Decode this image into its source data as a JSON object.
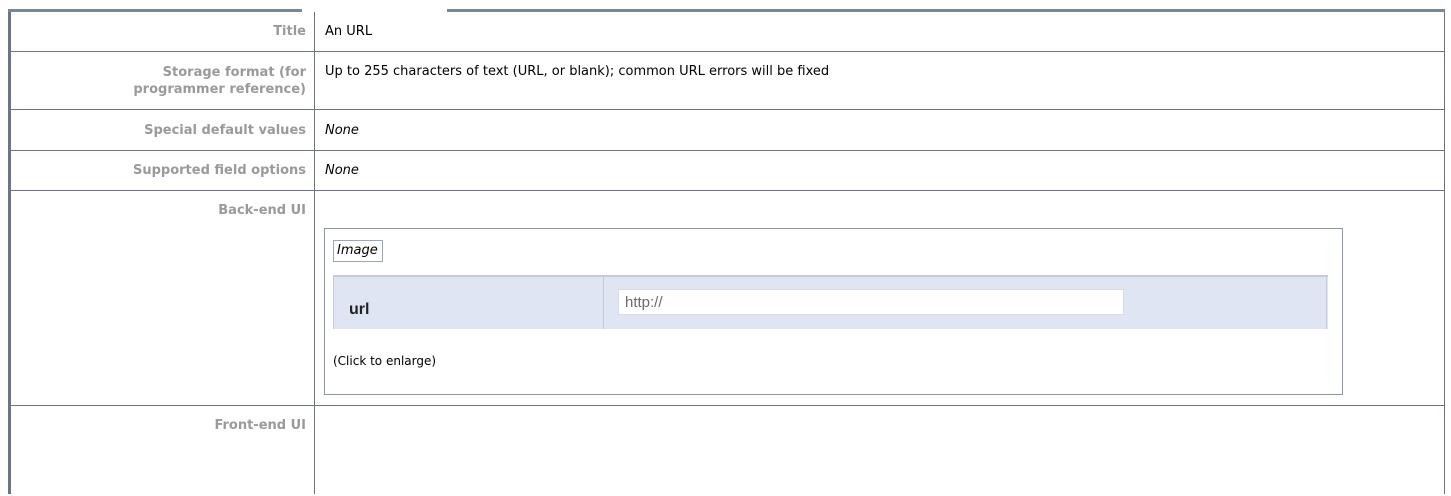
{
  "rows": {
    "title": {
      "label": "Title",
      "value": "An URL"
    },
    "storage": {
      "label_line1": "Storage format (for",
      "label_line2": "programmer reference)",
      "value": "Up to 255 characters of text (URL, or blank); common URL errors will be fixed"
    },
    "defaults": {
      "label": "Special default values",
      "value": "None"
    },
    "options": {
      "label": "Supported field options",
      "value": "None"
    },
    "backend": {
      "label": "Back-end UI"
    },
    "frontend": {
      "label": "Front-end UI"
    }
  },
  "image": {
    "tag": "Image",
    "field_label": "url",
    "field_value": "http://",
    "caption": "(Click to enlarge)"
  }
}
